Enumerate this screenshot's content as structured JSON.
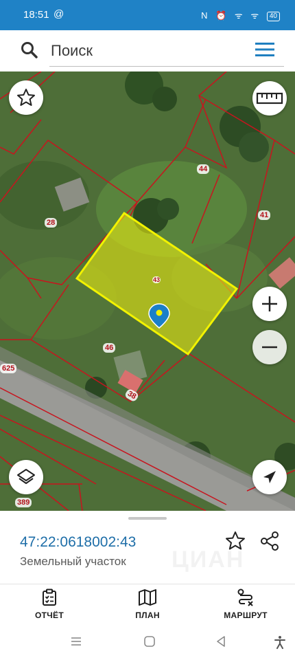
{
  "status_bar": {
    "time": "18:51",
    "at": "@",
    "icons": "N ⏰ ᯤ ᯤ",
    "battery": "40"
  },
  "search": {
    "placeholder": "Поиск",
    "value": ""
  },
  "map": {
    "parcel_labels": [
      "44",
      "41",
      "28",
      "46",
      "38",
      "625",
      "389",
      "43"
    ]
  },
  "object": {
    "cad_number": "47:22:0618002:43",
    "type": "Земельный участок"
  },
  "watermark": "ЦИАН",
  "bottom_nav": [
    {
      "label": "ОТЧЁТ",
      "icon": "report-icon"
    },
    {
      "label": "ПЛАН",
      "icon": "map-plan-icon"
    },
    {
      "label": "МАРШРУТ",
      "icon": "route-icon"
    }
  ],
  "colors": {
    "brand": "#1f82c6",
    "parcel_border": "#c8141e",
    "selected_parcel": "#f2f200",
    "link": "#1e6ea8"
  }
}
